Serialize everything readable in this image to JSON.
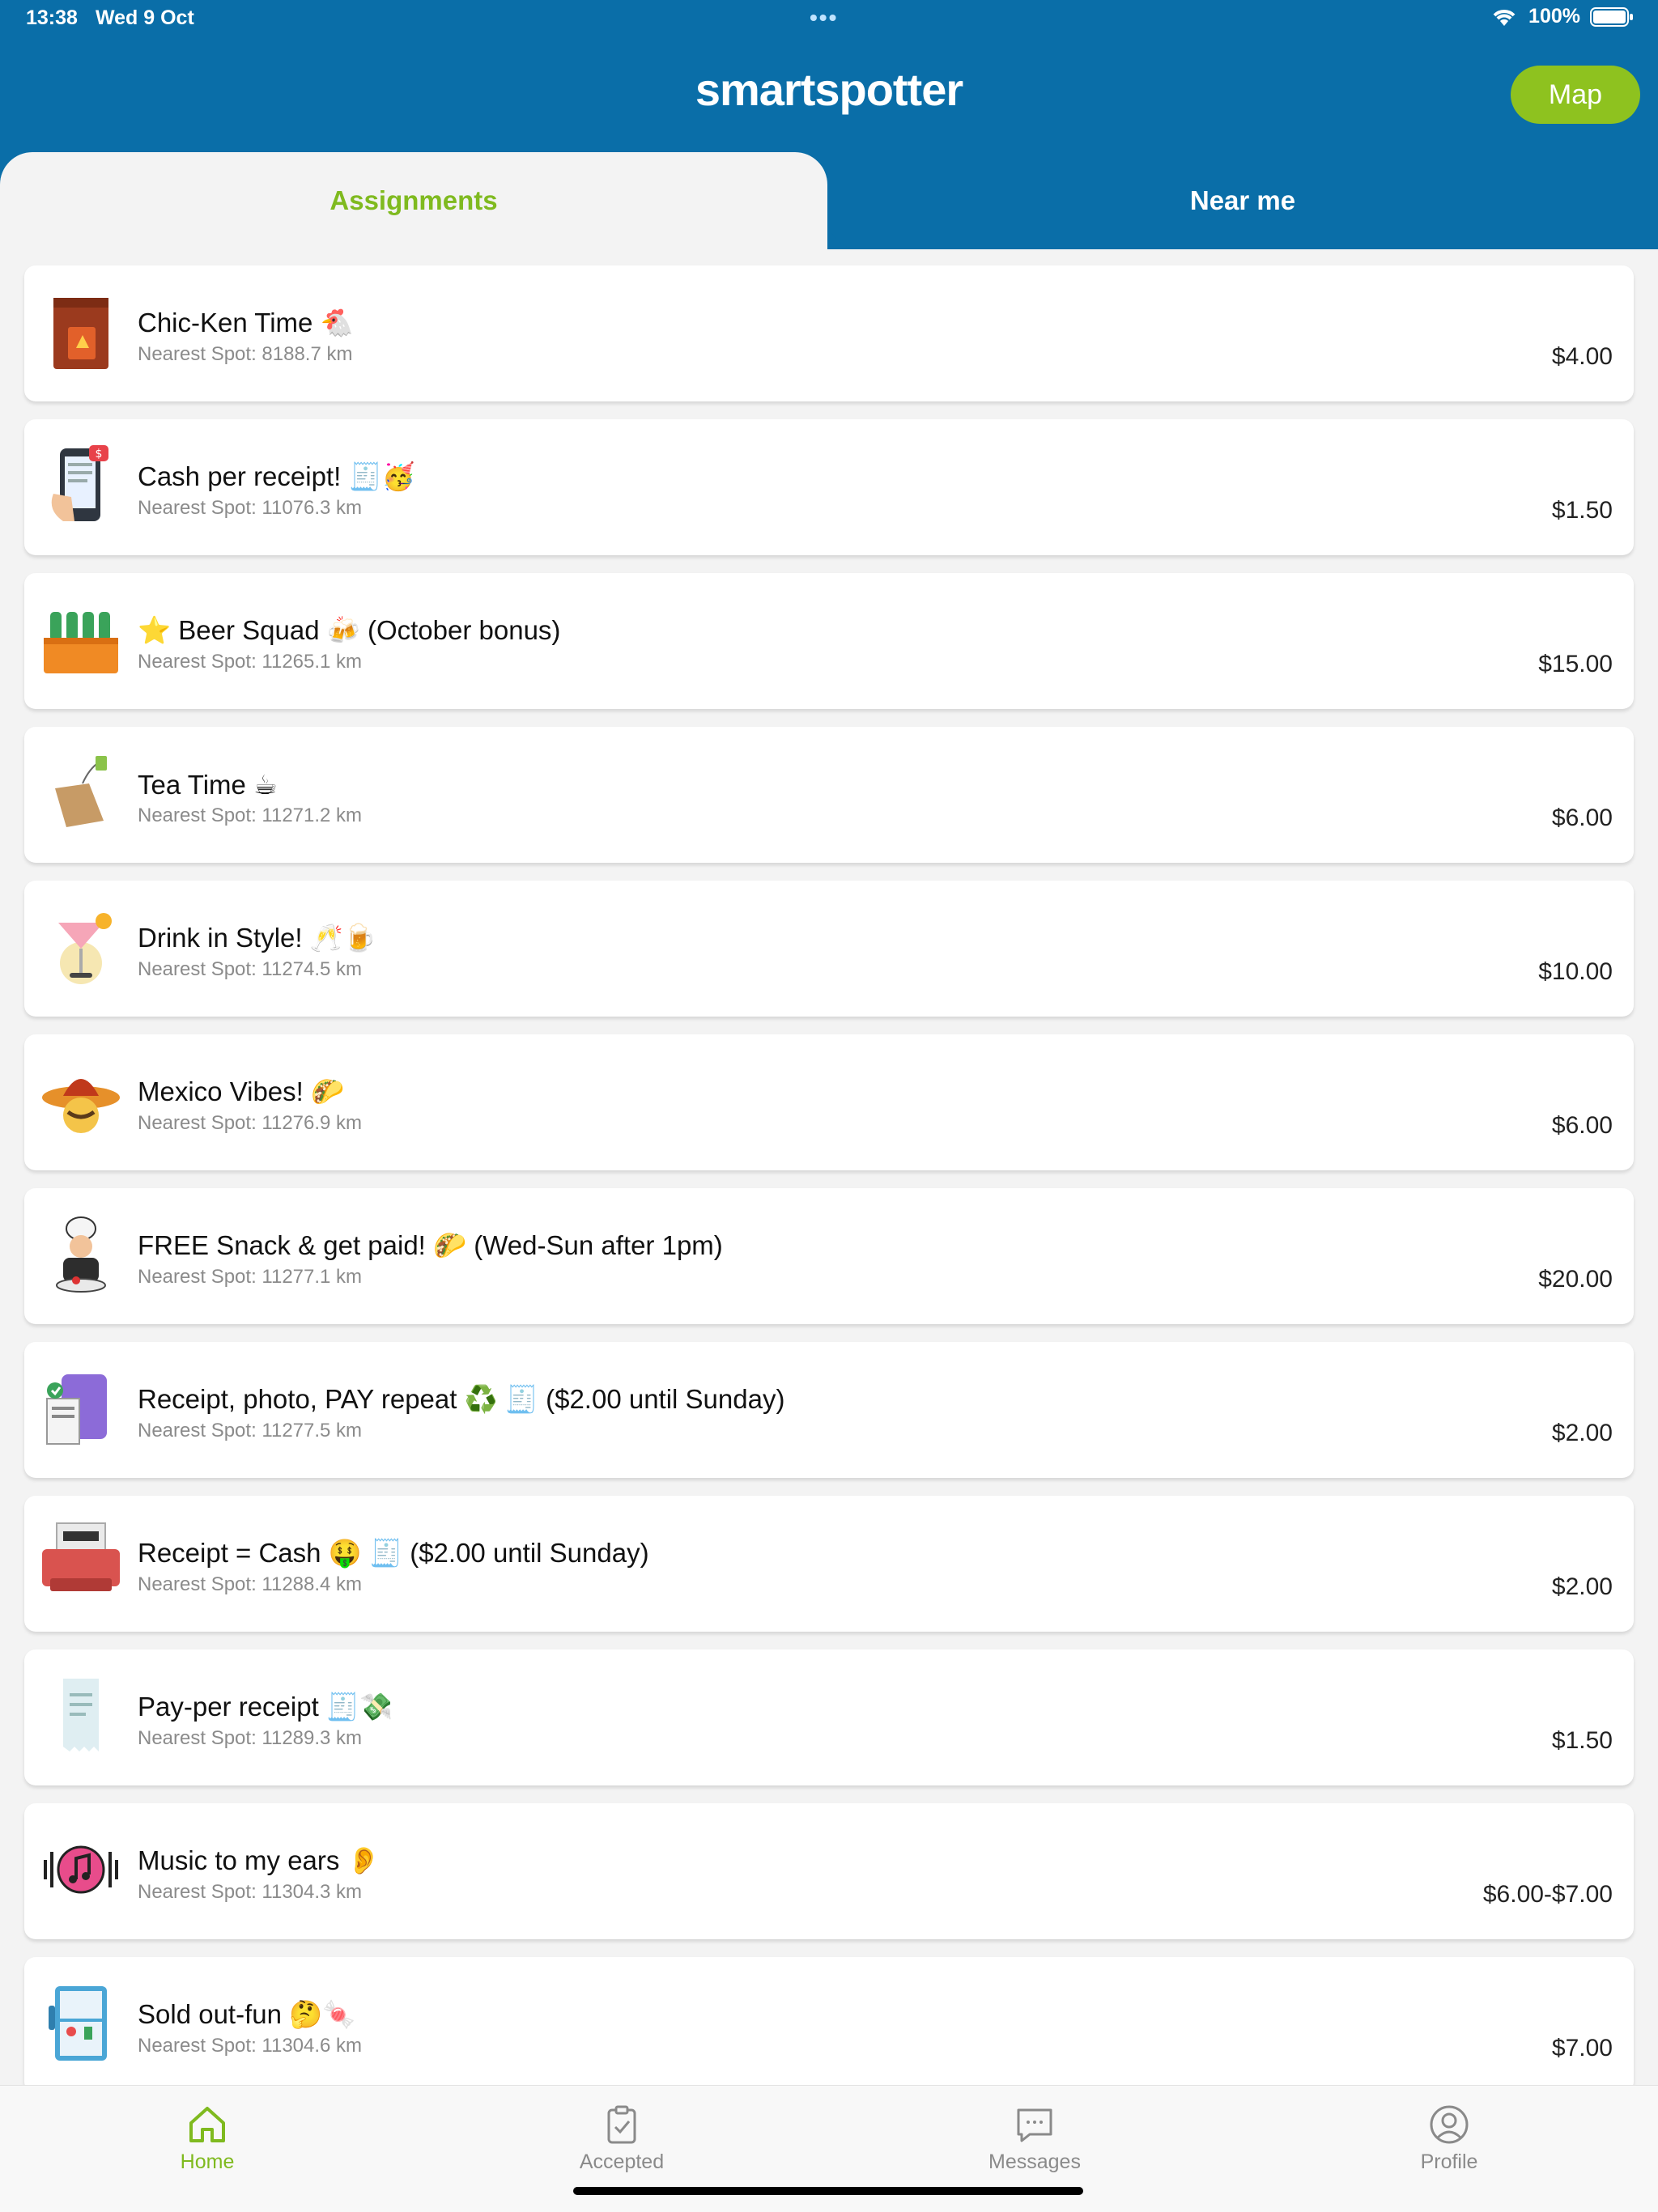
{
  "status_bar": {
    "time": "13:38",
    "date": "Wed 9 Oct",
    "battery": "100%"
  },
  "header": {
    "title": "smartspotter",
    "map_label": "Map"
  },
  "tabs": {
    "assignments": "Assignments",
    "near_me": "Near me",
    "active": "assignments"
  },
  "assignments": [
    {
      "title": "Chic-Ken Time 🐔",
      "nearest": "Nearest Spot: 8188.7 km",
      "price": "$4.00",
      "icon": "chicken-bag-icon"
    },
    {
      "title": "Cash per receipt! 🧾🥳",
      "nearest": "Nearest Spot: 11076.3 km",
      "price": "$1.50",
      "icon": "phone-receipt-icon"
    },
    {
      "title": "⭐ Beer Squad 🍻 (October bonus)",
      "nearest": "Nearest Spot: 11265.1 km",
      "price": "$15.00",
      "icon": "beer-crate-icon"
    },
    {
      "title": "Tea Time ☕",
      "nearest": "Nearest Spot: 11271.2 km",
      "price": "$6.00",
      "icon": "tea-bag-icon"
    },
    {
      "title": "Drink in Style! 🥂🍺",
      "nearest": "Nearest Spot: 11274.5 km",
      "price": "$10.00",
      "icon": "cocktail-icon"
    },
    {
      "title": "Mexico Vibes! 🌮",
      "nearest": "Nearest Spot: 11276.9 km",
      "price": "$6.00",
      "icon": "sombrero-icon"
    },
    {
      "title": "FREE Snack & get paid! 🌮  (Wed-Sun after 1pm)",
      "nearest": "Nearest Spot: 11277.1 km",
      "price": "$20.00",
      "icon": "chef-icon"
    },
    {
      "title": "Receipt, photo, PAY repeat ♻️ 🧾 ($2.00 until Sunday)",
      "nearest": "Nearest Spot: 11277.5 km",
      "price": "$2.00",
      "icon": "receipt-phone-icon"
    },
    {
      "title": "Receipt = Cash 🤑 🧾 ($2.00 until Sunday)",
      "nearest": "Nearest Spot: 11288.4 km",
      "price": "$2.00",
      "icon": "receipt-printer-icon"
    },
    {
      "title": "Pay-per receipt 🧾💸",
      "nearest": "Nearest Spot: 11289.3 km",
      "price": "$1.50",
      "icon": "receipt-icon"
    },
    {
      "title": "Music to my ears 👂",
      "nearest": "Nearest Spot: 11304.3 km",
      "price": "$6.00-$7.00",
      "icon": "music-note-icon"
    },
    {
      "title": "Sold out-fun 🤔🍬",
      "nearest": "Nearest Spot: 11304.6 km",
      "price": "$7.00",
      "icon": "fridge-icon"
    }
  ],
  "bottom_nav": {
    "home": "Home",
    "accepted": "Accepted",
    "messages": "Messages",
    "profile": "Profile",
    "active": "home"
  },
  "colors": {
    "brand_blue": "#0a6ea8",
    "accent_green": "#8ec21f"
  }
}
